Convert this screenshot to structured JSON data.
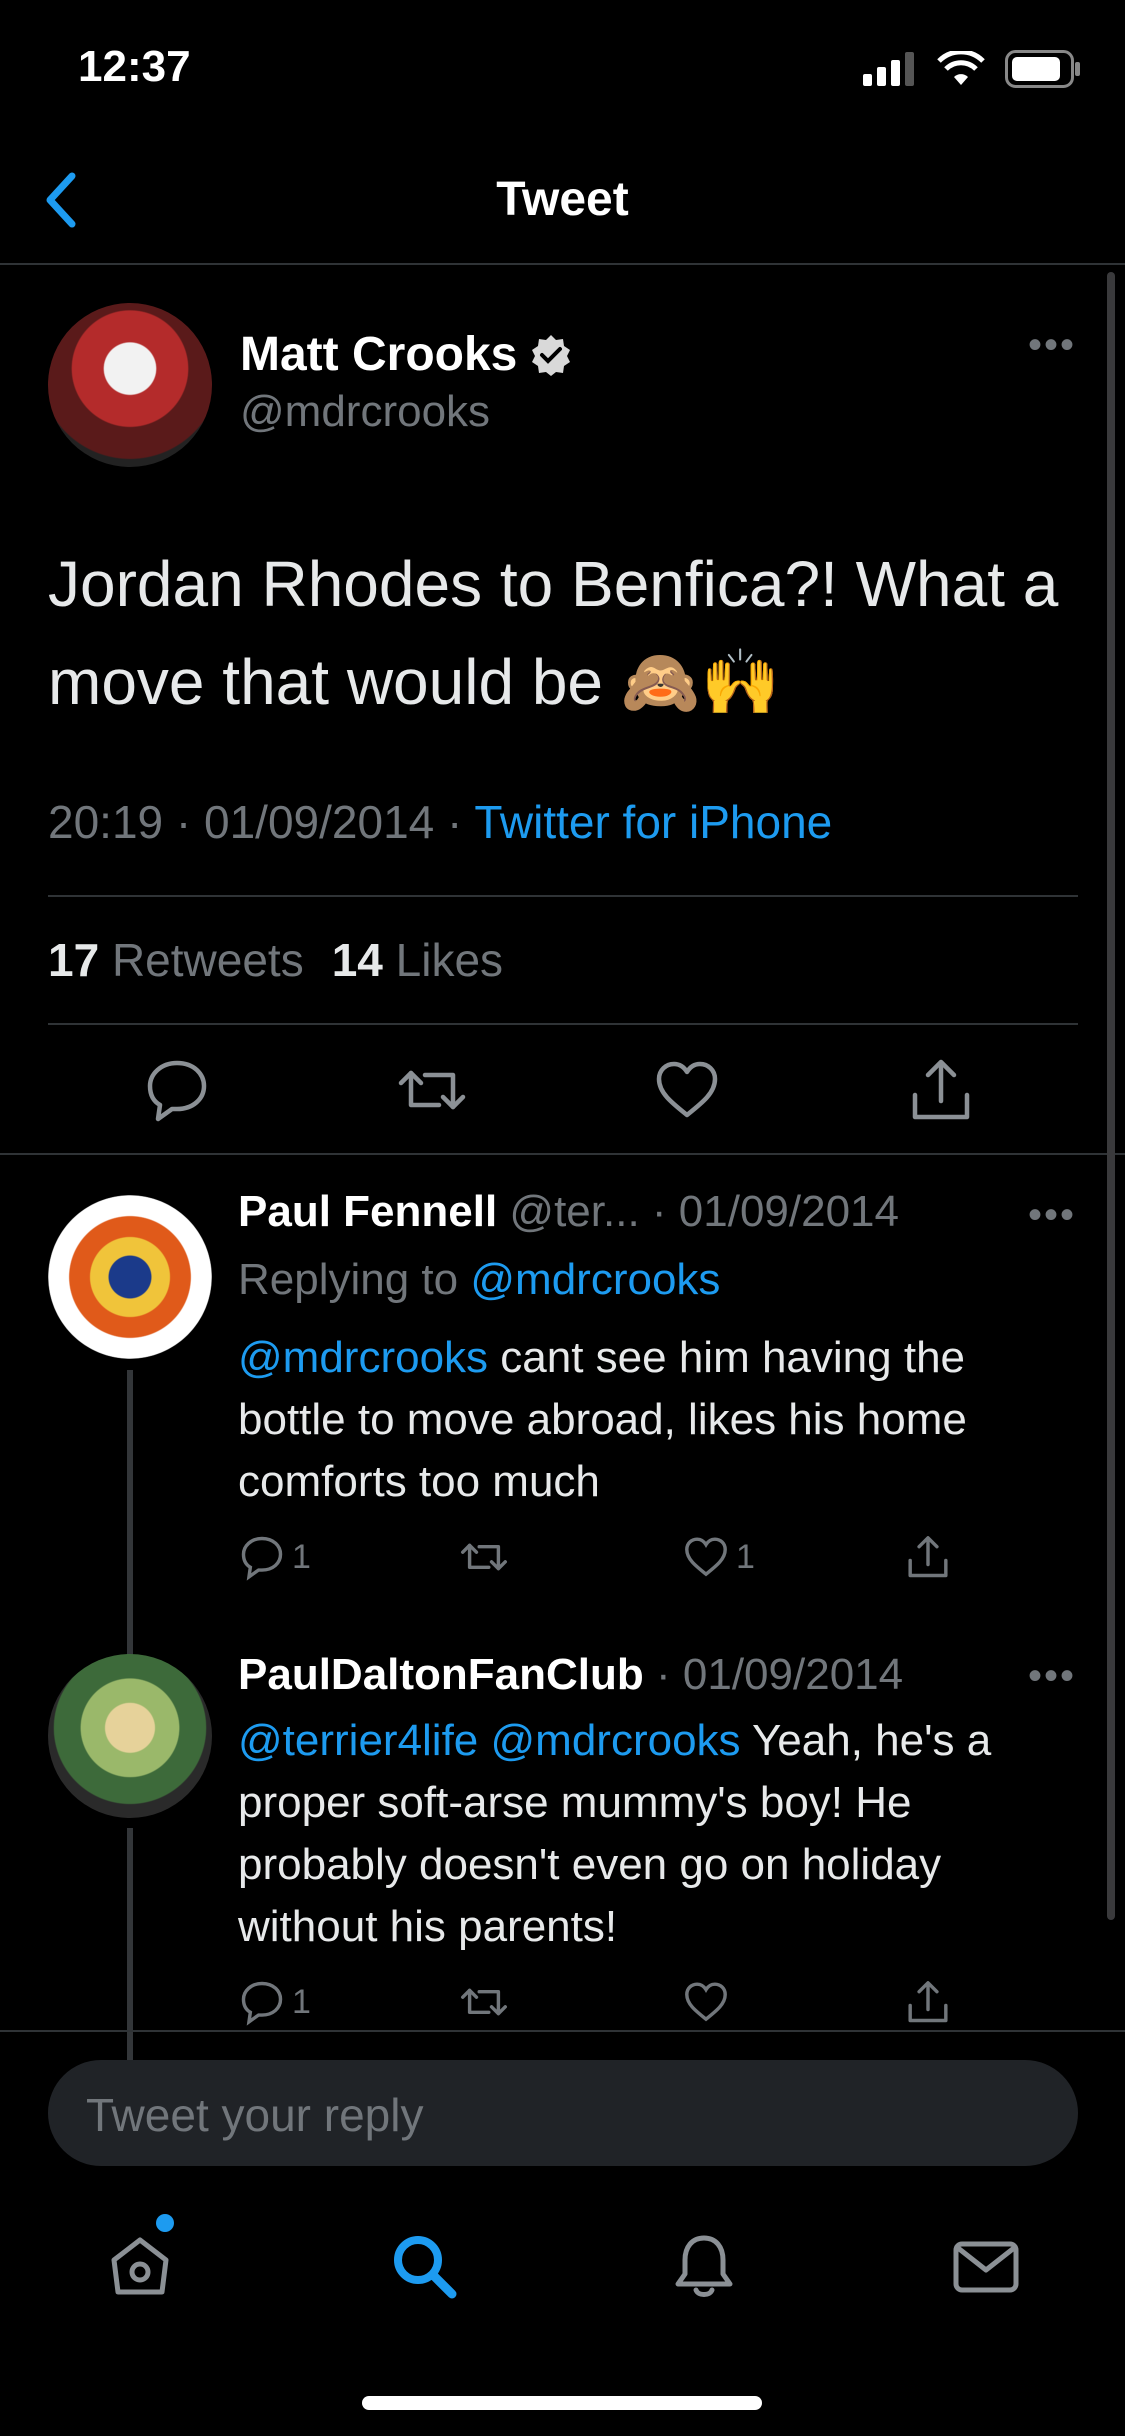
{
  "status_bar": {
    "time": "12:37"
  },
  "nav": {
    "title": "Tweet"
  },
  "tweet": {
    "author_name": "Matt Crooks",
    "author_handle": "@mdrcrooks",
    "text": "Jordan Rhodes to Benfica?! What a move that would be 🙈🙌",
    "time": "20:19",
    "date": "01/09/2014",
    "source": "Twitter for iPhone",
    "retweets_count": "17",
    "retweets_label": "Retweets",
    "likes_count": "14",
    "likes_label": "Likes"
  },
  "replies": [
    {
      "name": "Paul Fennell",
      "handle": "@ter...",
      "date": "· 01/09/2014",
      "replying_prefix": "Replying to",
      "replying_handle": "@mdrcrooks",
      "mention": "@mdrcrooks",
      "text": "cant see him having the bottle to move abroad, likes his home comforts too much",
      "reply_count": "1",
      "like_count": "1"
    },
    {
      "name": "PaulDaltonFanClub",
      "date": "· 01/09/2014",
      "mentions": "@terrier4life @mdrcrooks",
      "text": "Yeah, he's a proper soft-arse mummy's boy! He probably doesn't even go on holiday without his parents!",
      "reply_count": "1"
    }
  ],
  "composer": {
    "placeholder": "Tweet your reply"
  },
  "tabbar": {
    "items": [
      "home-icon",
      "search-icon",
      "notifications-icon",
      "messages-icon"
    ]
  },
  "colors": {
    "accent": "#1d9bf0",
    "background": "#000000",
    "secondary_text": "#71767b"
  }
}
